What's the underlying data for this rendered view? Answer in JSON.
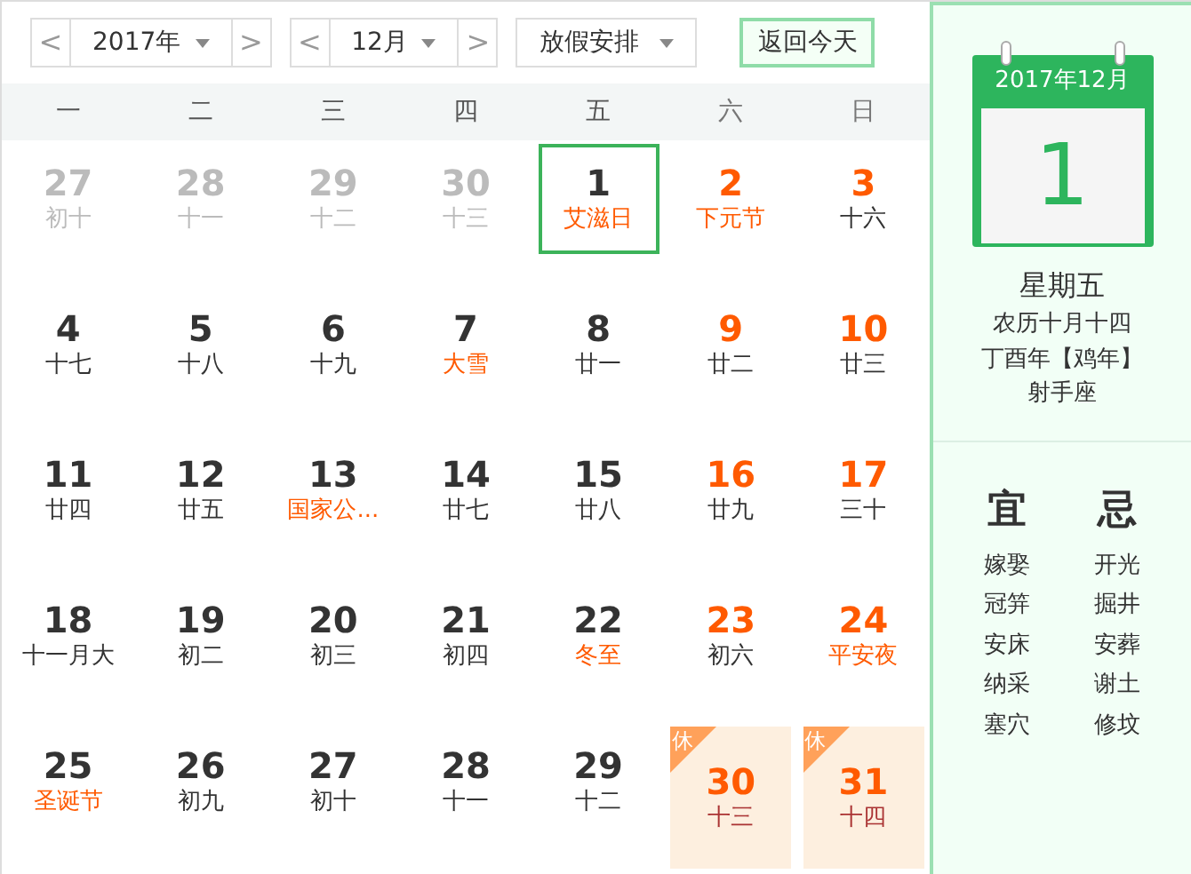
{
  "toolbar": {
    "year": {
      "prev": "<",
      "value": "2017年",
      "next": ">"
    },
    "month": {
      "prev": "<",
      "value": "12月",
      "next": ">"
    },
    "holiday_select": "放假安排",
    "today_button": "返回今天"
  },
  "weekdays": [
    {
      "label": "一",
      "weekend": false
    },
    {
      "label": "二",
      "weekend": false
    },
    {
      "label": "三",
      "weekend": false
    },
    {
      "label": "四",
      "weekend": false
    },
    {
      "label": "五",
      "weekend": false
    },
    {
      "label": "六",
      "weekend": true
    },
    {
      "label": "日",
      "weekend": true
    }
  ],
  "days": [
    {
      "day": "27",
      "sub": "初十",
      "other_month": true,
      "selected": false
    },
    {
      "day": "28",
      "sub": "十一",
      "other_month": true,
      "selected": false
    },
    {
      "day": "29",
      "sub": "十二",
      "other_month": true,
      "selected": false
    },
    {
      "day": "30",
      "sub": "十三",
      "other_month": true,
      "selected": false
    },
    {
      "day": "1",
      "sub": "艾滋日",
      "other_month": false,
      "weekend": false,
      "festival": true,
      "selected": true
    },
    {
      "day": "2",
      "sub": "下元节",
      "other_month": false,
      "weekend": true,
      "festival": true,
      "selected": false
    },
    {
      "day": "3",
      "sub": "十六",
      "other_month": false,
      "weekend": true,
      "festival": false,
      "selected": false
    },
    {
      "day": "4",
      "sub": "十七",
      "other_month": false,
      "weekend": false,
      "festival": false,
      "selected": false
    },
    {
      "day": "5",
      "sub": "十八",
      "other_month": false,
      "weekend": false,
      "festival": false,
      "selected": false
    },
    {
      "day": "6",
      "sub": "十九",
      "other_month": false,
      "weekend": false,
      "festival": false,
      "selected": false
    },
    {
      "day": "7",
      "sub": "大雪",
      "other_month": false,
      "weekend": false,
      "festival": true,
      "selected": false
    },
    {
      "day": "8",
      "sub": "廿一",
      "other_month": false,
      "weekend": false,
      "festival": false,
      "selected": false
    },
    {
      "day": "9",
      "sub": "廿二",
      "other_month": false,
      "weekend": true,
      "festival": false,
      "selected": false
    },
    {
      "day": "10",
      "sub": "廿三",
      "other_month": false,
      "weekend": true,
      "festival": false,
      "selected": false
    },
    {
      "day": "11",
      "sub": "廿四",
      "other_month": false,
      "weekend": false,
      "festival": false,
      "selected": false
    },
    {
      "day": "12",
      "sub": "廿五",
      "other_month": false,
      "weekend": false,
      "festival": false,
      "selected": false
    },
    {
      "day": "13",
      "sub": "国家公...",
      "other_month": false,
      "weekend": false,
      "festival": true,
      "selected": false
    },
    {
      "day": "14",
      "sub": "廿七",
      "other_month": false,
      "weekend": false,
      "festival": false,
      "selected": false
    },
    {
      "day": "15",
      "sub": "廿八",
      "other_month": false,
      "weekend": false,
      "festival": false,
      "selected": false
    },
    {
      "day": "16",
      "sub": "廿九",
      "other_month": false,
      "weekend": true,
      "festival": false,
      "selected": false
    },
    {
      "day": "17",
      "sub": "三十",
      "other_month": false,
      "weekend": true,
      "festival": false,
      "selected": false
    },
    {
      "day": "18",
      "sub": "十一月大",
      "other_month": false,
      "weekend": false,
      "festival": false,
      "selected": false
    },
    {
      "day": "19",
      "sub": "初二",
      "other_month": false,
      "weekend": false,
      "festival": false,
      "selected": false
    },
    {
      "day": "20",
      "sub": "初三",
      "other_month": false,
      "weekend": false,
      "festival": false,
      "selected": false
    },
    {
      "day": "21",
      "sub": "初四",
      "other_month": false,
      "weekend": false,
      "festival": false,
      "selected": false
    },
    {
      "day": "22",
      "sub": "冬至",
      "other_month": false,
      "weekend": false,
      "festival": true,
      "selected": false
    },
    {
      "day": "23",
      "sub": "初六",
      "other_month": false,
      "weekend": true,
      "festival": false,
      "selected": false
    },
    {
      "day": "24",
      "sub": "平安夜",
      "other_month": false,
      "weekend": true,
      "festival": true,
      "selected": false
    },
    {
      "day": "25",
      "sub": "圣诞节",
      "other_month": false,
      "weekend": false,
      "festival": true,
      "selected": false
    },
    {
      "day": "26",
      "sub": "初九",
      "other_month": false,
      "weekend": false,
      "festival": false,
      "selected": false
    },
    {
      "day": "27",
      "sub": "初十",
      "other_month": false,
      "weekend": false,
      "festival": false,
      "selected": false
    },
    {
      "day": "28",
      "sub": "十一",
      "other_month": false,
      "weekend": false,
      "festival": false,
      "selected": false
    },
    {
      "day": "29",
      "sub": "十二",
      "other_month": false,
      "weekend": false,
      "festival": false,
      "selected": false
    },
    {
      "day": "30",
      "sub": "十三",
      "other_month": false,
      "weekend": true,
      "festival": false,
      "rest": "休",
      "selected": false
    },
    {
      "day": "31",
      "sub": "十四",
      "other_month": false,
      "weekend": true,
      "festival": false,
      "rest": "休",
      "selected": false
    }
  ],
  "side": {
    "card_header": "2017年12月",
    "card_day": "1",
    "weekday": "星期五",
    "lunar": "农历十月十四",
    "ganzhi": "丁酉年【鸡年】",
    "zodiac": "射手座",
    "good": {
      "title": "宜",
      "items": [
        "嫁娶",
        "冠笄",
        "安床",
        "纳采",
        "塞穴"
      ]
    },
    "bad": {
      "title": "忌",
      "items": [
        "开光",
        "掘井",
        "安葬",
        "谢土",
        "修坟"
      ]
    }
  }
}
